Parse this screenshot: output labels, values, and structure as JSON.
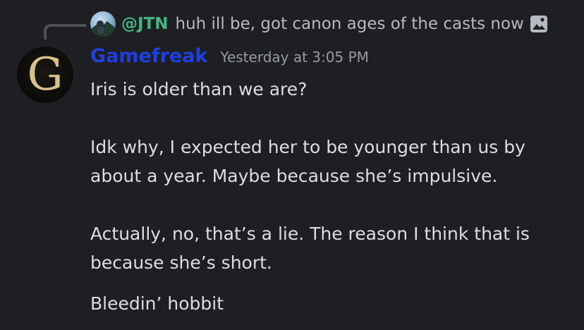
{
  "reply": {
    "mention": "@JTN",
    "text": "huh ill be, got canon ages of the casts now",
    "avatar_icon": "reply-avatar-image",
    "attachment_icon": "image-icon"
  },
  "author": {
    "name": "Gamefreak",
    "avatar_letter": "G",
    "name_color": "#1f3fe0"
  },
  "timestamp": "Yesterday at 3:05 PM",
  "message": {
    "line1": "Iris is older than we are?",
    "para2": "Idk why, I expected her to be younger than us by about a year. Maybe because she’s impulsive.",
    "para3": "Actually, no, that’s a lie. The reason I think that is because she’s short."
  },
  "followup": "Bleedin’ hobbit",
  "colors": {
    "background": "#1e1f22",
    "mention": "#43b581",
    "text": "#dbdee1",
    "muted": "#949ba4"
  }
}
